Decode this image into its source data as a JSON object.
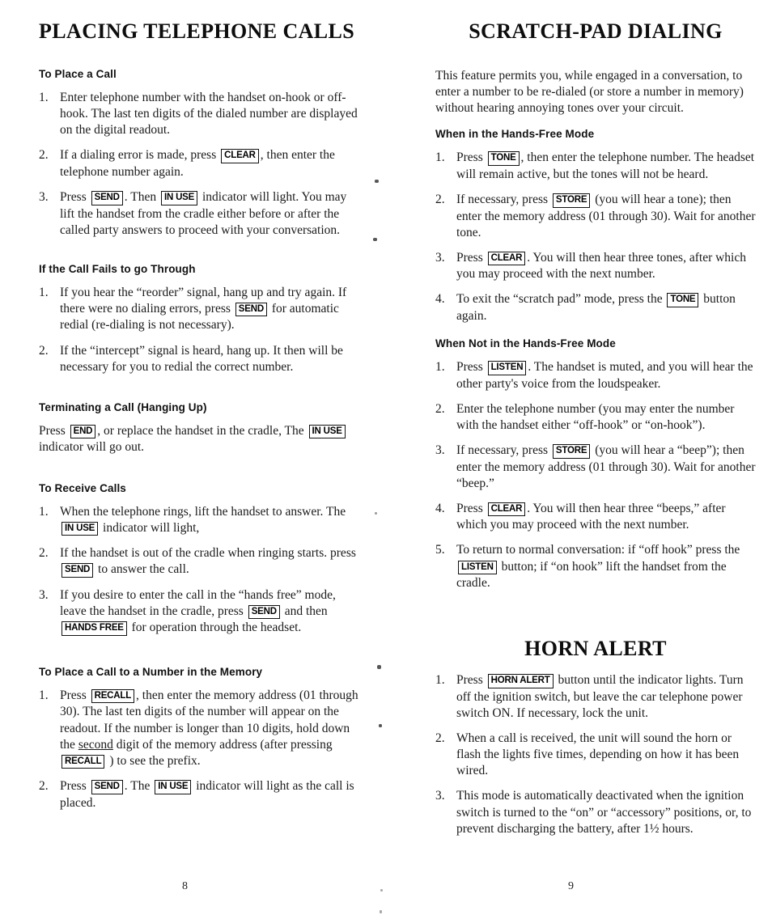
{
  "document": {
    "left_page_number": "8",
    "right_page_number": "9"
  },
  "left_column": {
    "title": "PLACING TELEPHONE CALLS",
    "sections": [
      {
        "heading": "To Place a Call",
        "steps": [
          {
            "num": "1.",
            "parts": [
              {
                "t": "text",
                "v": "Enter telephone number with the handset on-hook or off-hook. The last ten digits of the dialed number are displayed on the digital readout."
              }
            ]
          },
          {
            "num": "2.",
            "parts": [
              {
                "t": "text",
                "v": "If a dialing error is made, press "
              },
              {
                "t": "btn",
                "v": "CLEAR"
              },
              {
                "t": "text",
                "v": ", then enter the telephone number again."
              }
            ]
          },
          {
            "num": "3.",
            "parts": [
              {
                "t": "text",
                "v": "Press "
              },
              {
                "t": "btn",
                "v": "SEND"
              },
              {
                "t": "text",
                "v": ". Then "
              },
              {
                "t": "btn",
                "v": "IN USE"
              },
              {
                "t": "text",
                "v": " indicator will light. You may lift the handset from the cradle either before or after the called party answers to proceed with your conversation."
              }
            ]
          }
        ]
      },
      {
        "heading": "If the Call Fails to go Through",
        "steps": [
          {
            "num": "1.",
            "parts": [
              {
                "t": "text",
                "v": "If you hear the “reorder” signal, hang up and try again. If there were no dialing errors, press "
              },
              {
                "t": "btn",
                "v": "SEND"
              },
              {
                "t": "text",
                "v": " for automatic redial (re-dialing is not necessary)."
              }
            ]
          },
          {
            "num": "2.",
            "parts": [
              {
                "t": "text",
                "v": "If the “intercept” signal is heard, hang up. It then will be necessary for you to redial the correct number."
              }
            ]
          }
        ]
      },
      {
        "heading": "Terminating a Call (Hanging Up)",
        "paragraph": [
          {
            "t": "text",
            "v": "Press "
          },
          {
            "t": "btn",
            "v": "END"
          },
          {
            "t": "text",
            "v": ", or replace the handset in the cradle, The "
          },
          {
            "t": "btn",
            "v": "IN USE"
          },
          {
            "t": "text",
            "v": " indicator will go out."
          }
        ]
      },
      {
        "heading": "To Receive Calls",
        "steps": [
          {
            "num": "1.",
            "parts": [
              {
                "t": "text",
                "v": "When the telephone rings, lift the handset to answer. The "
              },
              {
                "t": "btn",
                "v": "IN USE"
              },
              {
                "t": "text",
                "v": " indicator will light,"
              }
            ]
          },
          {
            "num": "2.",
            "parts": [
              {
                "t": "text",
                "v": "If the handset is out of the cradle when ringing starts. press "
              },
              {
                "t": "btn",
                "v": "SEND"
              },
              {
                "t": "text",
                "v": " to answer the call."
              }
            ]
          },
          {
            "num": "3.",
            "parts": [
              {
                "t": "text",
                "v": "If you desire to enter the call in the “hands free” mode, leave the handset in the cradle, press "
              },
              {
                "t": "btn",
                "v": "SEND"
              },
              {
                "t": "text",
                "v": " and then "
              },
              {
                "t": "btn",
                "v": "HANDS FREE"
              },
              {
                "t": "text",
                "v": " for operation through the headset."
              }
            ]
          }
        ]
      },
      {
        "heading": "To Place a Call to a Number in the Memory",
        "steps": [
          {
            "num": "1.",
            "parts": [
              {
                "t": "text",
                "v": "Press "
              },
              {
                "t": "btn",
                "v": "RECALL"
              },
              {
                "t": "text",
                "v": ", then enter the memory address  (01 through 30). The last ten digits of the number will appear on the readout. If the number is longer than 10 digits, hold down the "
              },
              {
                "t": "u",
                "v": "second"
              },
              {
                "t": "text",
                "v": " digit of the memory address (after pressing "
              },
              {
                "t": "btn",
                "v": "RECALL"
              },
              {
                "t": "text",
                "v": " ) to see the prefix."
              }
            ]
          },
          {
            "num": "2.",
            "parts": [
              {
                "t": "text",
                "v": "Press "
              },
              {
                "t": "btn",
                "v": "SEND"
              },
              {
                "t": "text",
                "v": ". The "
              },
              {
                "t": "btn",
                "v": "IN USE"
              },
              {
                "t": "text",
                "v": " indicator will light as the call is placed."
              }
            ]
          }
        ]
      }
    ]
  },
  "right_column": {
    "title": "SCRATCH-PAD DIALING",
    "intro": "This feature permits you, while engaged in a conversation, to enter a number to be re-dialed (or store a number in memory) without hearing annoying tones over your circuit.",
    "sections": [
      {
        "heading": "When in the Hands-Free Mode",
        "steps": [
          {
            "num": "1.",
            "parts": [
              {
                "t": "text",
                "v": "Press "
              },
              {
                "t": "btn",
                "v": "TONE"
              },
              {
                "t": "text",
                "v": ", then enter the telephone number. The headset will remain active, but the tones will not be heard."
              }
            ]
          },
          {
            "num": "2.",
            "parts": [
              {
                "t": "text",
                "v": "If necessary, press "
              },
              {
                "t": "btn",
                "v": "STORE"
              },
              {
                "t": "text",
                "v": " (you will hear a tone); then enter the memory address (01 through 30). Wait for another tone."
              }
            ]
          },
          {
            "num": "3.",
            "parts": [
              {
                "t": "text",
                "v": "Press "
              },
              {
                "t": "btn",
                "v": "CLEAR"
              },
              {
                "t": "text",
                "v": ". You will then hear three tones, after which you may proceed with the next number."
              }
            ]
          },
          {
            "num": "4.",
            "parts": [
              {
                "t": "text",
                "v": "To exit the “scratch pad” mode, press the "
              },
              {
                "t": "btn",
                "v": "TONE"
              },
              {
                "t": "text",
                "v": " button again."
              }
            ]
          }
        ]
      },
      {
        "heading": "When Not in the Hands-Free Mode",
        "steps": [
          {
            "num": "1.",
            "parts": [
              {
                "t": "text",
                "v": "Press "
              },
              {
                "t": "btn",
                "v": "LISTEN"
              },
              {
                "t": "text",
                "v": ". The handset is muted, and you will hear the other party's voice from the loudspeaker."
              }
            ]
          },
          {
            "num": "2.",
            "parts": [
              {
                "t": "text",
                "v": "Enter the telephone number (you may enter the number with the handset either “off-hook” or “on-hook”)."
              }
            ]
          },
          {
            "num": "3.",
            "parts": [
              {
                "t": "text",
                "v": "If necessary, press "
              },
              {
                "t": "btn",
                "v": "STORE"
              },
              {
                "t": "text",
                "v": " (you will hear a “beep”); then enter the memory address (01 through 30). Wait for another “beep.”"
              }
            ]
          },
          {
            "num": "4.",
            "parts": [
              {
                "t": "text",
                "v": "Press "
              },
              {
                "t": "btn",
                "v": "CLEAR"
              },
              {
                "t": "text",
                "v": ". You will then hear three “beeps,” after which you may proceed with the next number."
              }
            ]
          },
          {
            "num": "5.",
            "parts": [
              {
                "t": "text",
                "v": "To return to normal conversation: if “off hook” press the "
              },
              {
                "t": "btn",
                "v": "LISTEN"
              },
              {
                "t": "text",
                "v": " button; if “on hook” lift the handset from the cradle."
              }
            ]
          }
        ]
      }
    ],
    "horn_alert": {
      "title": "HORN ALERT",
      "steps": [
        {
          "num": "1.",
          "parts": [
            {
              "t": "text",
              "v": "Press "
            },
            {
              "t": "btn",
              "v": "HORN ALERT"
            },
            {
              "t": "text",
              "v": " button until the indicator lights. Turn off the ignition switch, but leave the car telephone power switch ON. If necessary, lock the unit."
            }
          ]
        },
        {
          "num": "2.",
          "parts": [
            {
              "t": "text",
              "v": "When a call is received, the unit will sound the horn or flash the lights five times, depending on how it has been wired."
            }
          ]
        },
        {
          "num": "3.",
          "parts": [
            {
              "t": "text",
              "v": "This mode is automatically deactivated when the ignition switch is turned to the “on” or “accessory” positions, or, to prevent discharging the battery, after 1½ hours."
            }
          ]
        }
      ]
    }
  }
}
